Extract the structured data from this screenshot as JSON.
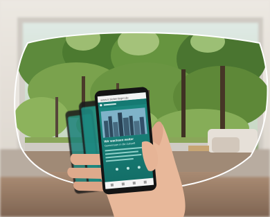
{
  "scene": {
    "description_colors": {
      "wall": "#e7e2db",
      "window_frame": "#c9c5bf",
      "foliage_dark": "#3d6b2e",
      "foliage_light": "#8fb35a",
      "phone_screen": "#1f8f86",
      "floor": "#9a7c64"
    }
  },
  "phone": {
    "url": "www.ir.siebenleger.de",
    "headline": "Wir wachsen weiter",
    "subline": "Gemeinsam in die Zukunft"
  }
}
